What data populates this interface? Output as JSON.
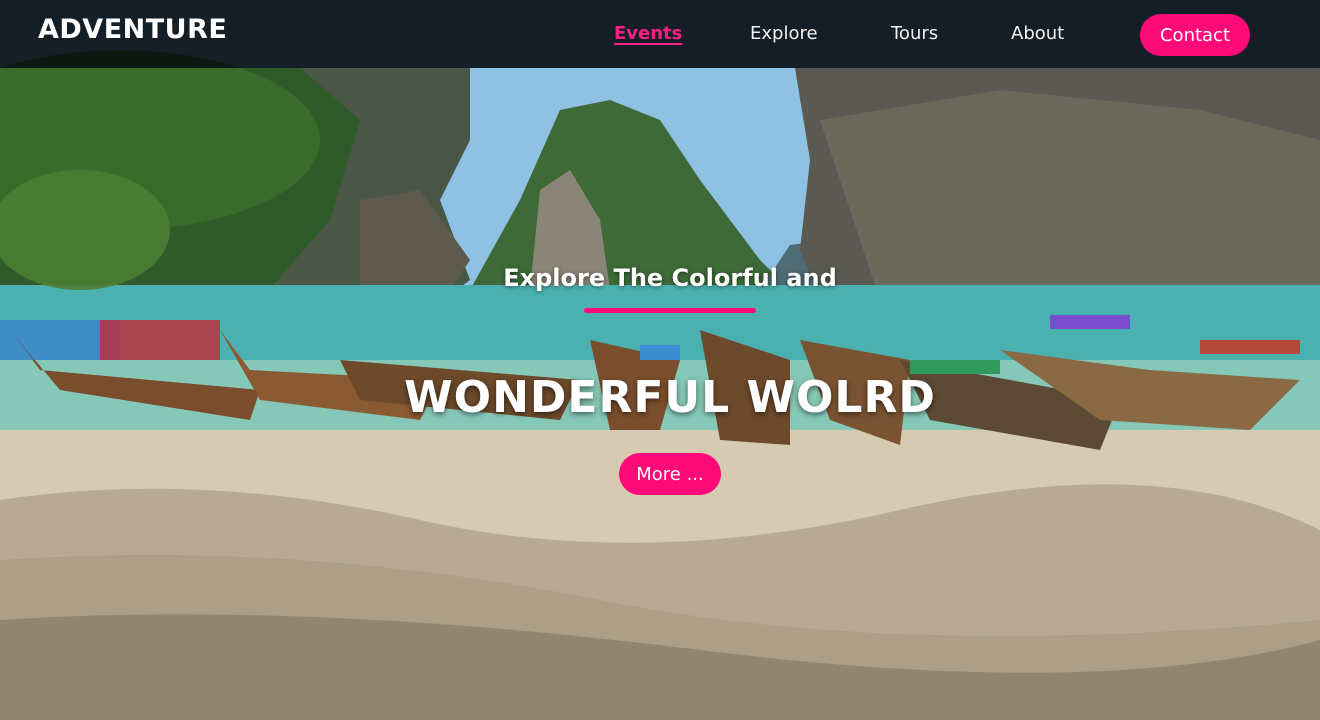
{
  "brand": {
    "logo": "ADVENTURE"
  },
  "nav": {
    "items": [
      {
        "label": "Events",
        "active": true
      },
      {
        "label": "Explore",
        "active": false
      },
      {
        "label": "Tours",
        "active": false
      },
      {
        "label": "About",
        "active": false
      }
    ],
    "contact_label": "Contact"
  },
  "hero": {
    "subtitle": "Explore The Colorful and",
    "title": "WONDERFUL WOLRD",
    "cta_label": "More ..."
  },
  "colors": {
    "accent": "#ff0a78",
    "navbar_bg": "#0a0c10",
    "text": "#ffffff"
  }
}
